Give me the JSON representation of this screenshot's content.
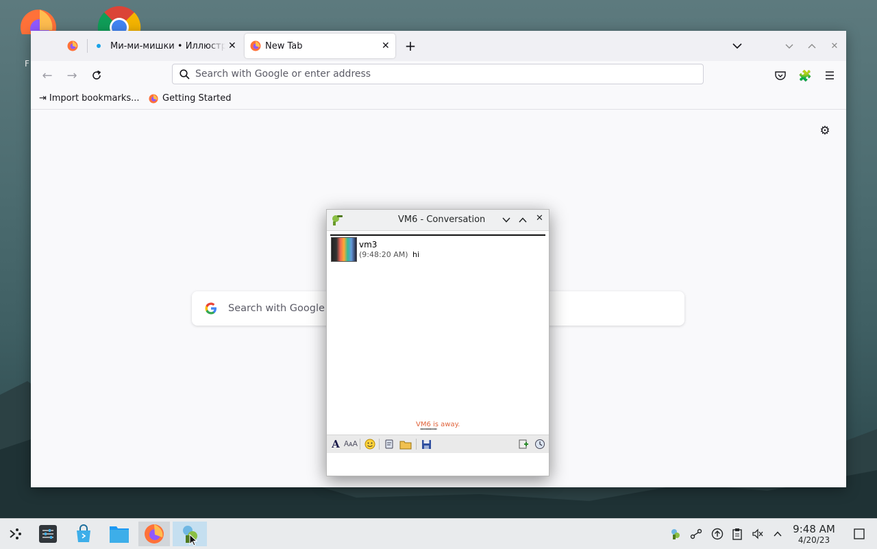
{
  "desktop": {
    "icons": [
      {
        "name": "firefox-desktop-icon",
        "label_partial": "F"
      },
      {
        "name": "chrome-desktop-icon",
        "label_partial": ""
      }
    ]
  },
  "browser": {
    "tabs": [
      {
        "label": ""
      },
      {
        "label": "Ми-ми-мишки • Иллюстр"
      },
      {
        "label": "New Tab"
      }
    ],
    "urlbar": {
      "placeholder": "Search with Google or enter address"
    },
    "bookmarks": [
      {
        "label": "Import bookmarks..."
      },
      {
        "label": "Getting Started"
      }
    ],
    "newtab": {
      "search_placeholder": "Search with Google or enter address"
    }
  },
  "conversation": {
    "title": "VM6 - Conversation",
    "messages": [
      {
        "sender": "vm3",
        "time": "(9:48:20 AM)",
        "text": "hi"
      }
    ],
    "status": "VM6 is away.",
    "typing_indicator": "''''''''''''''''''''''''''"
  },
  "taskbar": {
    "clock_time": "9:48 AM",
    "clock_date": "4/20/23"
  },
  "colors": {
    "status_away": "#e0623a",
    "accent_blue": "#0060df"
  }
}
